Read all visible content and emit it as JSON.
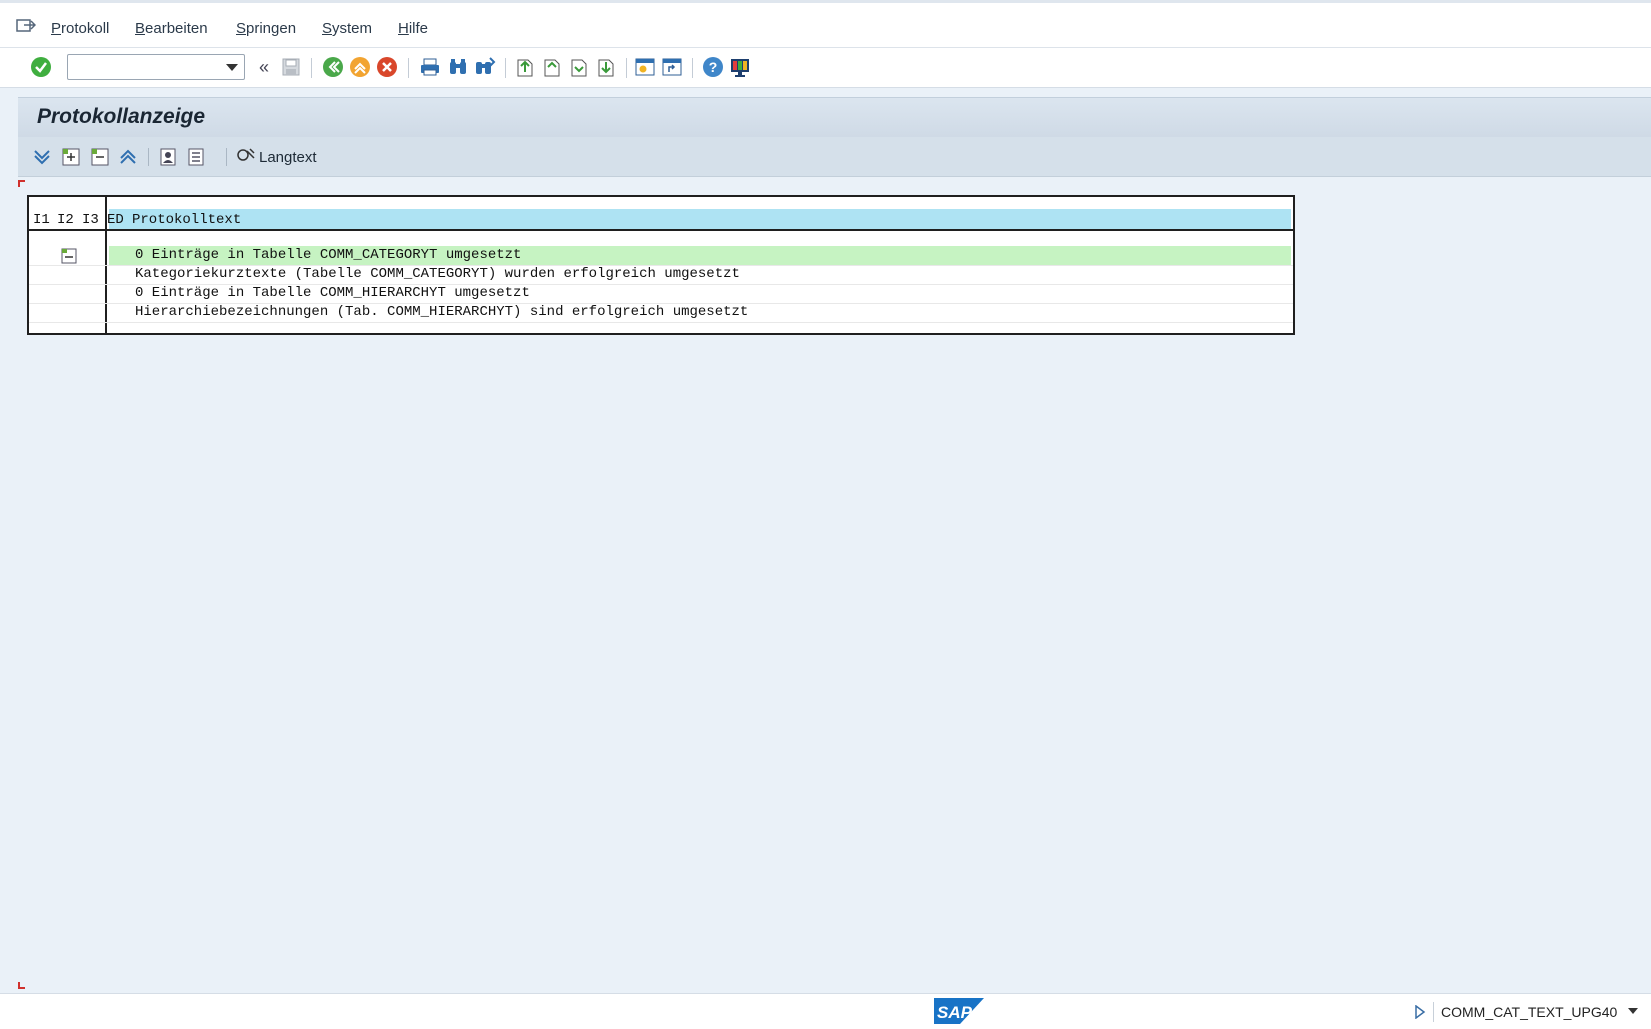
{
  "menubar": {
    "items": [
      {
        "label": "Protokoll"
      },
      {
        "label": "Bearbeiten"
      },
      {
        "label": "Springen"
      },
      {
        "label": "System"
      },
      {
        "label": "Hilfe"
      }
    ]
  },
  "toolbar": {
    "command_field": {
      "value": "",
      "placeholder": ""
    },
    "icons": [
      "enter-icon",
      "back-icon",
      "save-icon",
      "exit-icon",
      "cancel-icon",
      "print-icon",
      "find-icon",
      "find-next-icon",
      "first-page-icon",
      "previous-page-icon",
      "next-page-icon",
      "last-page-icon",
      "create-session-icon",
      "shortcut-icon",
      "help-icon",
      "customize-layout-icon"
    ]
  },
  "title": {
    "text": "Protokollanzeige"
  },
  "app_toolbar": {
    "langtext_label": "Langtext",
    "icons": [
      "expand-all-icon",
      "expand-node-icon",
      "collapse-node-icon",
      "collapse-all-icon",
      "user-detail-icon",
      "list-icon",
      "longtext-icon"
    ]
  },
  "log": {
    "header": {
      "i1": "I1",
      "i2": "I2",
      "i3": "I3",
      "ed": "ED",
      "text": "Protokolltext"
    },
    "rows": [
      {
        "text": "0 Einträge in Tabelle COMM_CATEGORYT umgesetzt"
      },
      {
        "text": "Kategoriekurztexte (Tabelle COMM_CATEGORYT) wurden erfolgreich umgesetzt"
      },
      {
        "text": "0 Einträge in Tabelle COMM_HIERARCHYT umgesetzt"
      },
      {
        "text": "Hierarchiebezeichnungen (Tab. COMM_HIERARCHYT) sind erfolgreich umgesetzt"
      }
    ]
  },
  "statusbar": {
    "logo": "SAP",
    "session": "COMM_CAT_TEXT_UPG40"
  },
  "colors": {
    "header_highlight": "#aee3f3",
    "row_highlight": "#c6f3c2",
    "background": "#eaf1f8",
    "sap_blue": "#1873c6"
  }
}
